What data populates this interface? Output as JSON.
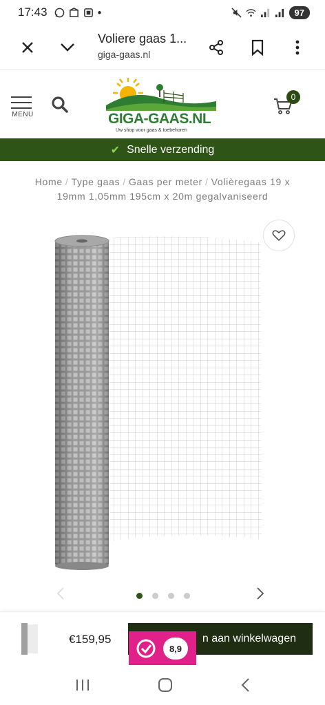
{
  "status_bar": {
    "time": "17:43",
    "battery": "97"
  },
  "browser": {
    "title": "Voliere gaas 1...",
    "url": "giga-gaas.nl"
  },
  "header": {
    "menu_label": "MENU",
    "logo_text": "GIGA-GAAS.NL",
    "logo_tagline": "Uw shop voor gaas & toebehoren",
    "cart_count": "0"
  },
  "shipping": {
    "text": "Snelle verzending"
  },
  "breadcrumb": {
    "items": [
      "Home",
      "Type gaas",
      "Gaas per meter",
      "Volièregaas 19 x 19mm 1,05mm 195cm x 20m gegalvaniseerd"
    ],
    "separator": "/"
  },
  "carousel": {
    "total_dots": 4,
    "active_index": 0
  },
  "sticky": {
    "price": "€159,95",
    "add_to_cart": "n aan winkelwagen",
    "review_score": "8,9"
  },
  "colors": {
    "brand_green": "#2e5417",
    "button_dark": "#1f2d12",
    "review_pink": "#e0218a"
  }
}
